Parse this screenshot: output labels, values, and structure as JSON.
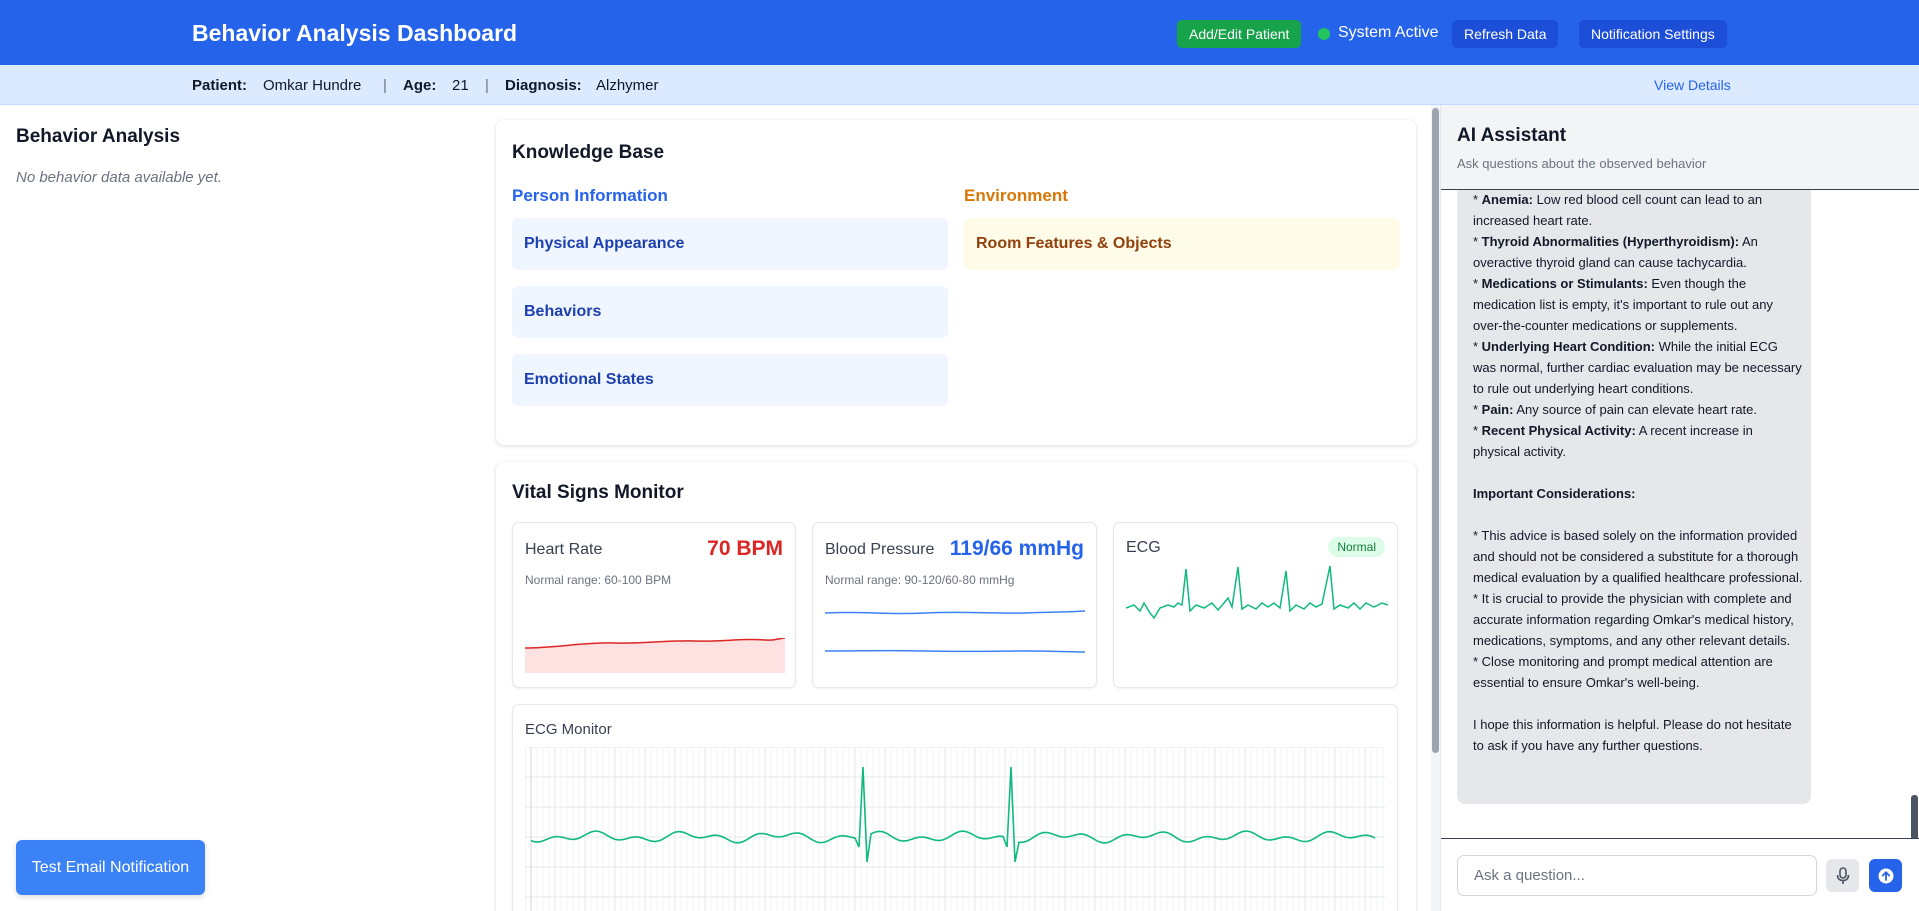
{
  "header": {
    "title": "Behavior Analysis Dashboard",
    "add_patient_label": "Add/Edit Patient",
    "status_text": "System Active",
    "refresh_label": "Refresh Data",
    "notifications_label": "Notification Settings"
  },
  "patient": {
    "name_label": "Patient:",
    "name": "Omkar Hundre",
    "age_label": "Age:",
    "age": "21",
    "diagnosis_label": "Diagnosis:",
    "diagnosis": "Alzhymer",
    "separator": "|",
    "view_details": "View Details"
  },
  "behavior_panel": {
    "title": "Behavior Analysis",
    "empty_text": "No behavior data available yet.",
    "test_email_label": "Test Email Notification"
  },
  "knowledge_base": {
    "title": "Knowledge Base",
    "person_heading": "Person Information",
    "person_items": [
      "Physical Appearance",
      "Behaviors",
      "Emotional States"
    ],
    "environment_heading": "Environment",
    "environment_items": [
      "Room Features & Objects"
    ]
  },
  "vitals": {
    "title": "Vital Signs Monitor",
    "heart_rate": {
      "label": "Heart Rate",
      "value": "70 BPM",
      "range": "Normal range: 60-100 BPM"
    },
    "blood_pressure": {
      "label": "Blood Pressure",
      "value": "119/66 mmHg",
      "range": "Normal range: 90-120/60-80 mmHg"
    },
    "ecg": {
      "label": "ECG",
      "status": "Normal"
    },
    "ecg_monitor_title": "ECG Monitor"
  },
  "assistant": {
    "title": "AI Assistant",
    "subtitle": "Ask questions about the observed behavior",
    "messages": [
      {
        "bullet": "* ",
        "bold": "Anemia:",
        "text": " Low red blood cell count can lead to an increased heart rate."
      },
      {
        "bullet": "* ",
        "bold": "Thyroid Abnormalities (Hyperthyroidism):",
        "text": " An overactive thyroid gland can cause tachycardia."
      },
      {
        "bullet": "* ",
        "bold": "Medications or Stimulants:",
        "text": " Even though the medication list is empty, it's important to rule out any over-the-counter medications or supplements."
      },
      {
        "bullet": "* ",
        "bold": "Underlying Heart Condition:",
        "text": " While the initial ECG was normal, further cardiac evaluation may be necessary to rule out underlying heart conditions."
      },
      {
        "bullet": "* ",
        "bold": "Pain:",
        "text": " Any source of pain can elevate heart rate."
      },
      {
        "bullet": "* ",
        "bold": "Recent Physical Activity:",
        "text": " A recent increase in physical activity."
      }
    ],
    "considerations_heading": "Important Considerations:",
    "considerations": [
      "* This advice is based solely on the information provided and should not be considered a substitute for a thorough medical evaluation by a qualified healthcare professional.",
      "* It is crucial to provide the physician with complete and accurate information regarding Omkar's medical history, medications, symptoms, and any other relevant details.",
      "* Close monitoring and prompt medical attention are essential to ensure Omkar's well-being."
    ],
    "closing": "I hope this information is helpful. Please do not hesitate to ask if you have any further questions.",
    "input_placeholder": "Ask a question..."
  },
  "colors": {
    "primary": "#2563eb",
    "success": "#16a34a",
    "heart": "#dc2626",
    "ecg": "#10b981",
    "bp": "#3b82f6"
  }
}
